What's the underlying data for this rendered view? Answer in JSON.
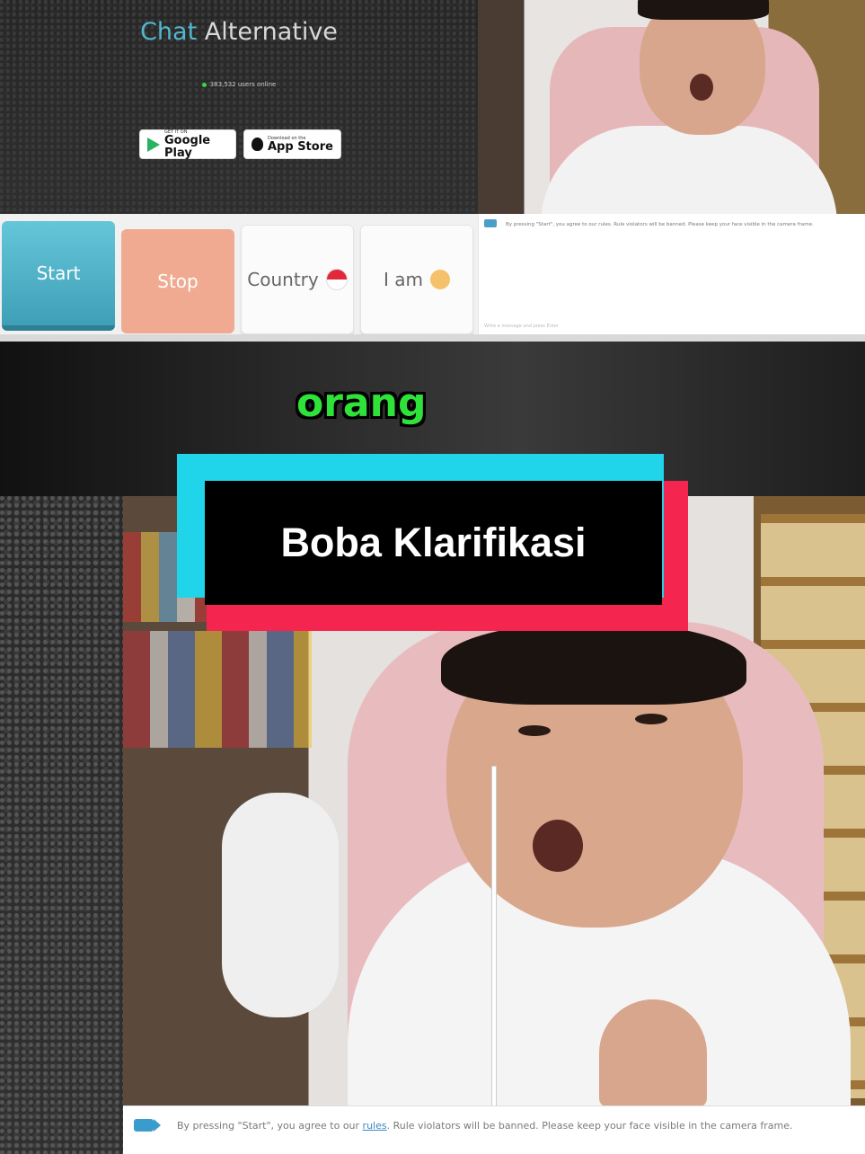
{
  "top": {
    "brand_prefix": "Chat",
    "brand_suffix": "Alternative",
    "online_text": "383,532 users online",
    "google_play_small": "GET IT ON",
    "google_play_big": "Google Play",
    "app_store_small": "Download on the",
    "app_store_big": "App Store",
    "buttons": {
      "start": "Start",
      "stop": "Stop",
      "country": "Country",
      "iam": "I am"
    },
    "chat_notice": "By pressing \"Start\", you agree to our rules. Rule violators will be banned. Please keep your face visible in the camera frame.",
    "chat_input_placeholder": "Write a message and press Enter"
  },
  "overlay": {
    "caption_word": "orang",
    "title_card": "Boba Klarifikasi"
  },
  "bottom": {
    "notice_before": "By pressing \"Start\", you agree to our",
    "notice_link": "rules",
    "notice_after": ". Rule violators will be banned. Please keep your face visible in the camera frame."
  },
  "colors": {
    "accent_cyan": "#20d4ea",
    "accent_red": "#f4254e",
    "caption_green": "#2fe23a",
    "start_button": "#4fb4cb",
    "stop_button": "#f0aa92"
  }
}
